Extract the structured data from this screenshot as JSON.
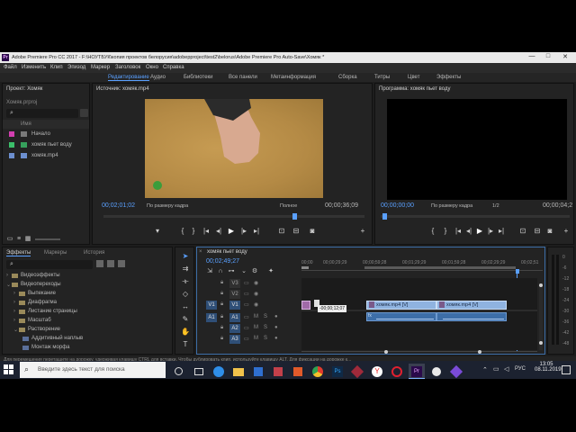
{
  "app": {
    "title": "Adobe Premiere Pro CC 2017 - F:\\НОУТБУК\\копия проектов белорусия\\adobepproject\\test2\\belorus\\Adobe Premiere Pro Auto-Save\\Хомяк *",
    "window_controls": [
      "—",
      "□",
      "✕"
    ]
  },
  "menu": [
    "Файл",
    "Изменить",
    "Клип",
    "Эпизод",
    "Маркер",
    "Заголовок",
    "Окно",
    "Справка"
  ],
  "workspaces": [
    "Редактирование",
    "Аудио",
    "Библиотеки",
    "Все панели",
    "Метаинформация",
    "Сборка",
    "Титры",
    "Цвет",
    "Эффекты"
  ],
  "project": {
    "title": "Проект: Хомяк",
    "file": "Хомяк.prproj",
    "col_name": "Имя",
    "items": [
      {
        "name": "Начало",
        "color": "#d23fb0"
      },
      {
        "name": "хомяк пьет воду",
        "color": "#3bbf6a"
      },
      {
        "name": "хомяк.mp4",
        "color": "#6c8fcf"
      }
    ]
  },
  "source": {
    "title": "Источник: хомяк.mp4",
    "timecode": "00;02;01;02",
    "fit": "По размеру кадра",
    "quality": "Полное",
    "duration": "00;00;36;09"
  },
  "program": {
    "title": "Программа: хомяк пьет воду",
    "timecode": "00;00;00;00",
    "fit": "По размеру кадра",
    "quality": "1/2",
    "duration": "00;00;04;2"
  },
  "effects": {
    "tabs": [
      "Эффекты",
      "Маркеры",
      "История"
    ],
    "items": [
      "Видеоэффекты",
      "Видеопереходы",
      "Выпекание",
      "Диафрагма",
      "Листание страницы",
      "Масштаб",
      "Растворение",
      "Аддитивный наплыв",
      "Монтаж морфа"
    ]
  },
  "timeline": {
    "tab": "хомяк пьет воду",
    "timecode": "00;02;49;27",
    "ruler": [
      "00;00",
      "00;00;29;29",
      "00;00;59;28",
      "00;01;29;29",
      "00;01;59;28",
      "00;02;29;29",
      "00;02;51"
    ],
    "tracks_video": [
      "V3",
      "V2",
      "V1"
    ],
    "tracks_audio": [
      "A1",
      "A2",
      "A3"
    ],
    "src_v": "V1",
    "src_a": "A1",
    "clip1_label": "хомяк.mp4 [V]",
    "clip2_label": "хомяк.mp4 [V]",
    "drag_tooltip": "-00;00;12;07",
    "audio_fx_label": "fx"
  },
  "status_text": "Для перемещения перетащите на дорожку, удерживая клавишу CTRL для вставки. Чтобы дублировать клип, используйте клавишу ALT. Для фиксации на дорожке к...",
  "taskbar": {
    "search_placeholder": "Введите здесь текст для поиска",
    "lang": "РУС",
    "time": "13:05",
    "date": "08.11.2019"
  },
  "audio_meter_scale": [
    "0",
    "-6",
    "-12",
    "-18",
    "-24",
    "-30",
    "-36",
    "-42",
    "-48"
  ]
}
